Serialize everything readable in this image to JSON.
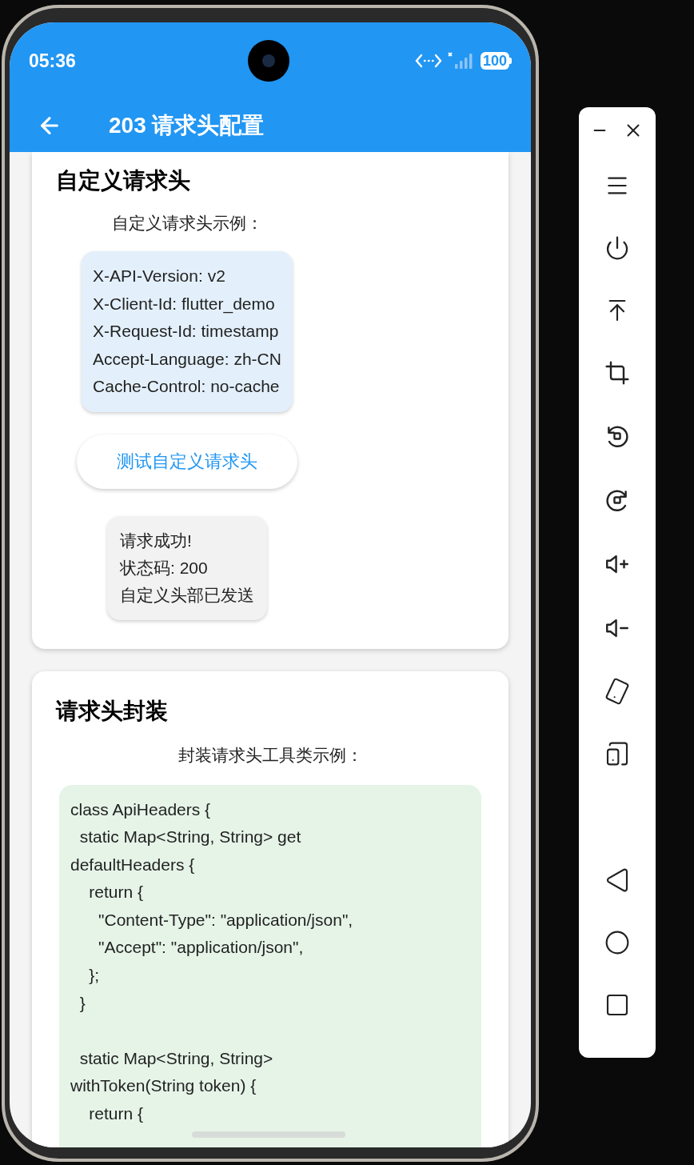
{
  "status_bar": {
    "time": "05:36",
    "battery": "100"
  },
  "app_bar": {
    "title": "203 请求头配置"
  },
  "sections": [
    {
      "kind": "demo",
      "title": "自定义请求头",
      "caption": "自定义请求头示例：",
      "headers": [
        "X-API-Version: v2",
        "X-Client-Id: flutter_demo",
        "X-Request-Id: timestamp",
        "Accept-Language: zh-CN",
        "Cache-Control: no-cache"
      ],
      "button": "测试自定义请求头",
      "result": [
        "请求成功!",
        "状态码: 200",
        "自定义头部已发送"
      ]
    },
    {
      "kind": "code",
      "title": "请求头封装",
      "caption": "封装请求头工具类示例：",
      "code": "class ApiHeaders {\n  static Map<String, String> get\ndefaultHeaders {\n    return {\n      \"Content-Type\": \"application/json\",\n      \"Accept\": \"application/json\",\n    };\n  }\n\n  static Map<String, String>\nwithToken(String token) {\n    return {"
    }
  ]
}
